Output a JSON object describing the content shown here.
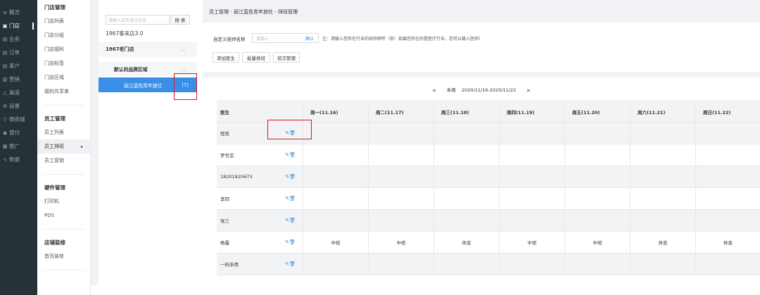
{
  "nav": [
    {
      "icon": "≡",
      "label": "概况"
    },
    {
      "icon": "▣",
      "label": "门店"
    },
    {
      "icon": "▤",
      "label": "业务"
    },
    {
      "icon": "▤",
      "label": "订单"
    },
    {
      "icon": "▤",
      "label": "客户"
    },
    {
      "icon": "▥",
      "label": "营销"
    },
    {
      "icon": "△",
      "label": "渠道"
    },
    {
      "icon": "⚙",
      "label": "设置"
    },
    {
      "icon": "▽",
      "label": "微商城"
    },
    {
      "icon": "◉",
      "label": "慧付"
    },
    {
      "icon": "▦",
      "label": "推广"
    },
    {
      "icon": "∿",
      "label": "数据"
    }
  ],
  "sub": {
    "store_group": "门店管理",
    "store_items": [
      "门店列表",
      "门店分组",
      "门店福利",
      "门店标签",
      "门店区域",
      "福利共享单"
    ],
    "staff_group": "员工管理",
    "staff_items": [
      "员工列表",
      "员工排班",
      "员工营销"
    ],
    "hw_group": "硬件管理",
    "hw_items": [
      "打印机",
      "POS"
    ],
    "shop_group": "店铺装修",
    "shop_items": [
      "首页装修"
    ]
  },
  "store": {
    "search_placeholder": "请输入店名或分店名",
    "search_btn": "搜 索",
    "brand": "1967客来店3.0",
    "group": "1967老门店",
    "region": "默认的品牌区域",
    "selected_name": "丽江蓝色青年旅社",
    "selected_count": "(7)"
  },
  "main": {
    "breadcrumb": "员工管理 - 丽江蓝色青年旅社 - 排班管理",
    "tech_label": "自定义技师名称",
    "tech_placeholder": "请输入",
    "confirm": "确认",
    "note": "注：请输入您所在行业的技师称呼（例：如果您所在的是医疗行业，您可以输入医师）",
    "buttons": [
      "添加医生",
      "批量排班",
      "班次管理"
    ],
    "week_label": "本周",
    "week_range": "2020/11/16-2020/11/22"
  },
  "table": {
    "headers": [
      "医生",
      "周一(11.16)",
      "周二(11.17)",
      "周三(11.18)",
      "周四(11.19)",
      "周五(11.20)",
      "周六(11.21)",
      "周日(11.22)"
    ],
    "rows": [
      {
        "name": "程凯",
        "cells": [
          "",
          "",
          "",
          "",
          "",
          "",
          ""
        ]
      },
      {
        "name": "罗世忠",
        "cells": [
          "",
          "",
          "",
          "",
          "",
          "",
          ""
        ]
      },
      {
        "name": "18201820673",
        "cells": [
          "",
          "",
          "",
          "",
          "",
          "",
          ""
        ]
      },
      {
        "name": "李四",
        "cells": [
          "",
          "",
          "",
          "",
          "",
          "",
          ""
        ]
      },
      {
        "name": "张三",
        "cells": [
          "",
          "",
          "",
          "",
          "",
          "",
          ""
        ]
      },
      {
        "name": "杨露",
        "cells": [
          "中班",
          "中班",
          "休息",
          "中班",
          "中班",
          "休息",
          "休息"
        ]
      },
      {
        "name": "一码多用",
        "cells": [
          "",
          "",
          "",
          "",
          "",
          "",
          ""
        ]
      }
    ]
  },
  "colors": {
    "accent": "#3a8ee6",
    "nav_bg": "#263238",
    "highlight": "#e0141e"
  }
}
